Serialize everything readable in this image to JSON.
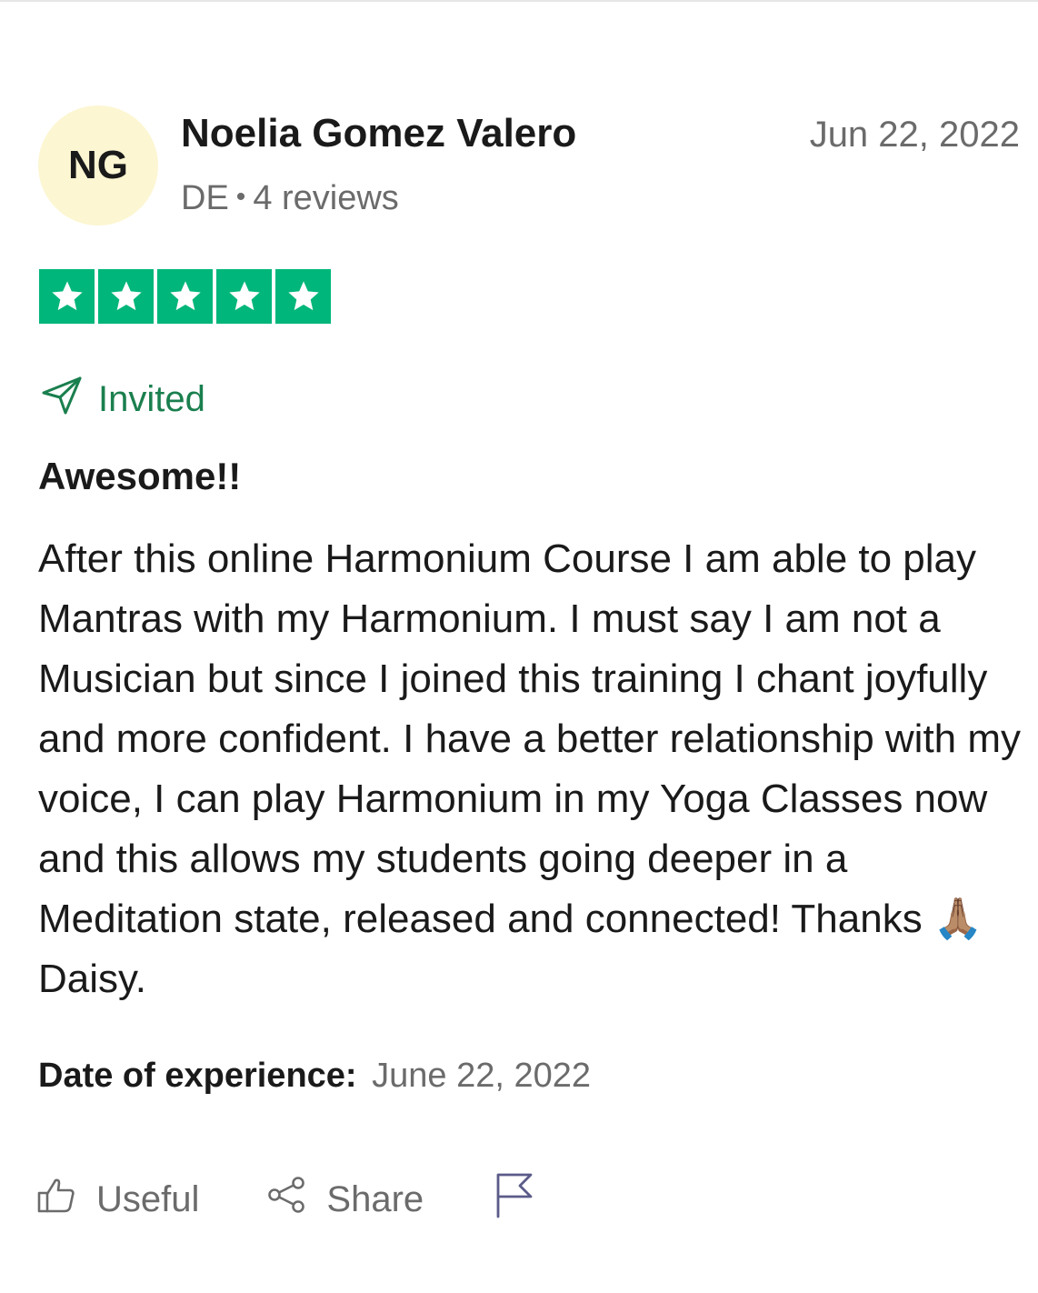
{
  "review": {
    "avatar_initials": "NG",
    "reviewer_name": "Noelia Gomez Valero",
    "country": "DE",
    "separator": "•",
    "review_count": "4 reviews",
    "date": "Jun 22, 2022",
    "rating": 5,
    "rating_max": 5,
    "invited_label": "Invited",
    "title": "Awesome!!",
    "body": "After this online Harmonium Course I am able to play Mantras with my Harmonium. I must say I am not a Musician but since I joined this training I chant joyfully and more confident. I have a better relationship with my voice, I can play Harmonium in my Yoga Classes now and this allows my students going deeper in a Meditation state, released and connected! Thanks 🙏🏽 Daisy.",
    "experience_label": "Date of experience:",
    "experience_date": "June 22, 2022"
  },
  "actions": {
    "useful_label": "Useful",
    "share_label": "Share",
    "useful_icon": "thumbs-up-icon",
    "share_icon": "share-icon",
    "flag_icon": "flag-icon"
  },
  "colors": {
    "star_green": "#00b67a",
    "invited_green": "#1a7f4e",
    "avatar_bg": "#fcf6d2",
    "muted_text": "#6b6b6b",
    "flag_color": "#5b5b8a"
  }
}
